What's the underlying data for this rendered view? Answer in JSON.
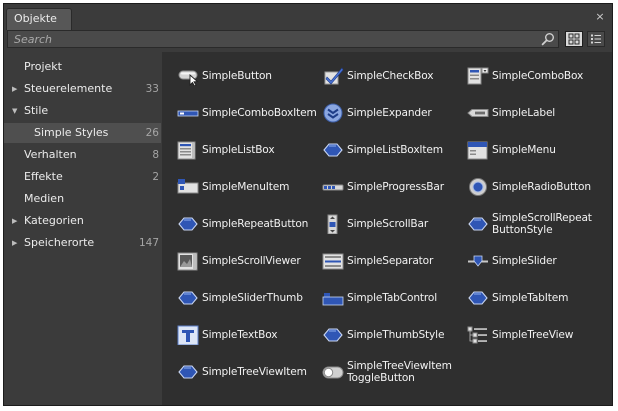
{
  "panel": {
    "tab_title": "Objekte",
    "close_glyph": "×"
  },
  "search": {
    "placeholder": "Search",
    "value": ""
  },
  "view_modes": [
    {
      "name": "grid-view",
      "active": true
    },
    {
      "name": "list-view",
      "active": false
    }
  ],
  "sidebar": {
    "items": [
      {
        "label": "Projekt",
        "count": "",
        "arrow": "",
        "indent": 0,
        "selected": false
      },
      {
        "label": "Steuerelemente",
        "count": "33",
        "arrow": "▶",
        "indent": 0,
        "selected": false
      },
      {
        "label": "Stile",
        "count": "",
        "arrow": "▼",
        "indent": 0,
        "selected": false
      },
      {
        "label": "Simple Styles",
        "count": "26",
        "arrow": "",
        "indent": 1,
        "selected": true
      },
      {
        "label": "Verhalten",
        "count": "8",
        "arrow": "",
        "indent": 0,
        "selected": false
      },
      {
        "label": "Effekte",
        "count": "2",
        "arrow": "",
        "indent": 0,
        "selected": false
      },
      {
        "label": "Medien",
        "count": "",
        "arrow": "",
        "indent": 0,
        "selected": false
      },
      {
        "label": "Kategorien",
        "count": "",
        "arrow": "▶",
        "indent": 0,
        "selected": false
      },
      {
        "label": "Speicherorte",
        "count": "147",
        "arrow": "▶",
        "indent": 0,
        "selected": false
      }
    ]
  },
  "assets": {
    "items": [
      {
        "label": "SimpleButton",
        "icon": "button-icon"
      },
      {
        "label": "SimpleCheckBox",
        "icon": "checkbox-icon"
      },
      {
        "label": "SimpleComboBox",
        "icon": "combobox-icon"
      },
      {
        "label": "SimpleComboBoxItem",
        "icon": "comboboxitem-icon"
      },
      {
        "label": "SimpleExpander",
        "icon": "expander-icon"
      },
      {
        "label": "SimpleLabel",
        "icon": "label-icon"
      },
      {
        "label": "SimpleListBox",
        "icon": "listbox-icon"
      },
      {
        "label": "SimpleListBoxItem",
        "icon": "style-icon"
      },
      {
        "label": "SimpleMenu",
        "icon": "menu-icon"
      },
      {
        "label": "SimpleMenuItem",
        "icon": "menuitem-icon"
      },
      {
        "label": "SimpleProgressBar",
        "icon": "progressbar-icon"
      },
      {
        "label": "SimpleRadioButton",
        "icon": "radiobutton-icon"
      },
      {
        "label": "SimpleRepeatButton",
        "icon": "style-icon"
      },
      {
        "label": "SimpleScrollBar",
        "icon": "scrollbar-icon"
      },
      {
        "label": "SimpleScrollRepeat ButtonStyle",
        "icon": "style-icon"
      },
      {
        "label": "SimpleScrollViewer",
        "icon": "scrollviewer-icon"
      },
      {
        "label": "SimpleSeparator",
        "icon": "separator-icon"
      },
      {
        "label": "SimpleSlider",
        "icon": "slider-icon"
      },
      {
        "label": "SimpleSliderThumb",
        "icon": "style-icon"
      },
      {
        "label": "SimpleTabControl",
        "icon": "tabcontrol-icon"
      },
      {
        "label": "SimpleTabItem",
        "icon": "style-icon"
      },
      {
        "label": "SimpleTextBox",
        "icon": "textbox-icon"
      },
      {
        "label": "SimpleThumbStyle",
        "icon": "style-icon"
      },
      {
        "label": "SimpleTreeView",
        "icon": "treeview-icon"
      },
      {
        "label": "SimpleTreeViewItem",
        "icon": "style-icon"
      },
      {
        "label": "SimpleTreeViewItem ToggleButton",
        "icon": "togglebutton-icon"
      }
    ]
  },
  "colors": {
    "panel_bg": "#3b3b3b",
    "content_bg": "#2f2f2f",
    "selected_row": "#4f4f4f",
    "style_icon_blue": "#2f56b5"
  }
}
